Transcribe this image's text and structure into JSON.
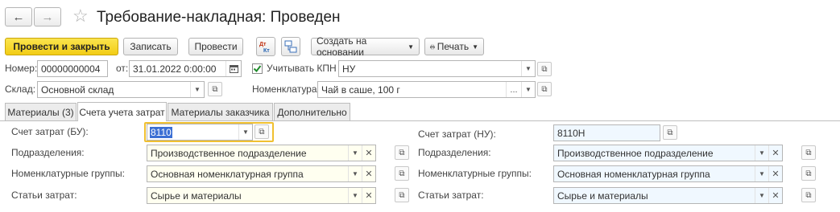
{
  "header": {
    "title": "Требование-накладная: Проведен",
    "back_icon": "arrow-left-icon",
    "forward_icon": "arrow-right-icon",
    "star_icon": "star-icon"
  },
  "toolbar": {
    "post_close": "Провести и закрыть",
    "write": "Записать",
    "post": "Провести",
    "dt_kt": "Дт Кт",
    "create_based": "Создать на основании",
    "print": "Печать"
  },
  "doc": {
    "number_label": "Номер:",
    "number_value": "00000000004",
    "date_label": "от:",
    "date_value": "31.01.2022  0:00:00",
    "kpn_label": "Учитывать КПН",
    "kpn_checked": true,
    "kpn_value": "НУ",
    "warehouse_label": "Склад:",
    "warehouse_value": "Основной склад",
    "nomenclature_label": "Номенклатура:",
    "nomenclature_value": "Чай в саше, 100 г"
  },
  "tabs": [
    {
      "label": "Материалы (3)"
    },
    {
      "label": "Счета учета затрат"
    },
    {
      "label": "Материалы заказчика"
    },
    {
      "label": "Дополнительно"
    }
  ],
  "bu": {
    "account_label": "Счет затрат (БУ):",
    "account_value": "8110",
    "division_label": "Подразделения:",
    "division_value": "Производственное подразделение",
    "group_label": "Номенклатурные группы:",
    "group_value": "Основная номенклатурная группа",
    "items_label": "Статьи затрат:",
    "items_value": "Сырье и материалы"
  },
  "nu": {
    "account_label": "Счет затрат (НУ):",
    "account_value": "8110Н",
    "division_label": "Подразделения:",
    "division_value": "Производственное подразделение",
    "group_label": "Номенклатурные группы:",
    "group_value": "Основная номенклатурная группа",
    "items_label": "Статьи затрат:",
    "items_value": "Сырье и материалы"
  },
  "colors": {
    "primary_button": "#f5d320",
    "focus_border": "#f0c030",
    "selection": "#3b6fd4",
    "bu_field_bg": "#fffff0",
    "nu_field_bg": "#f0f8ff"
  }
}
